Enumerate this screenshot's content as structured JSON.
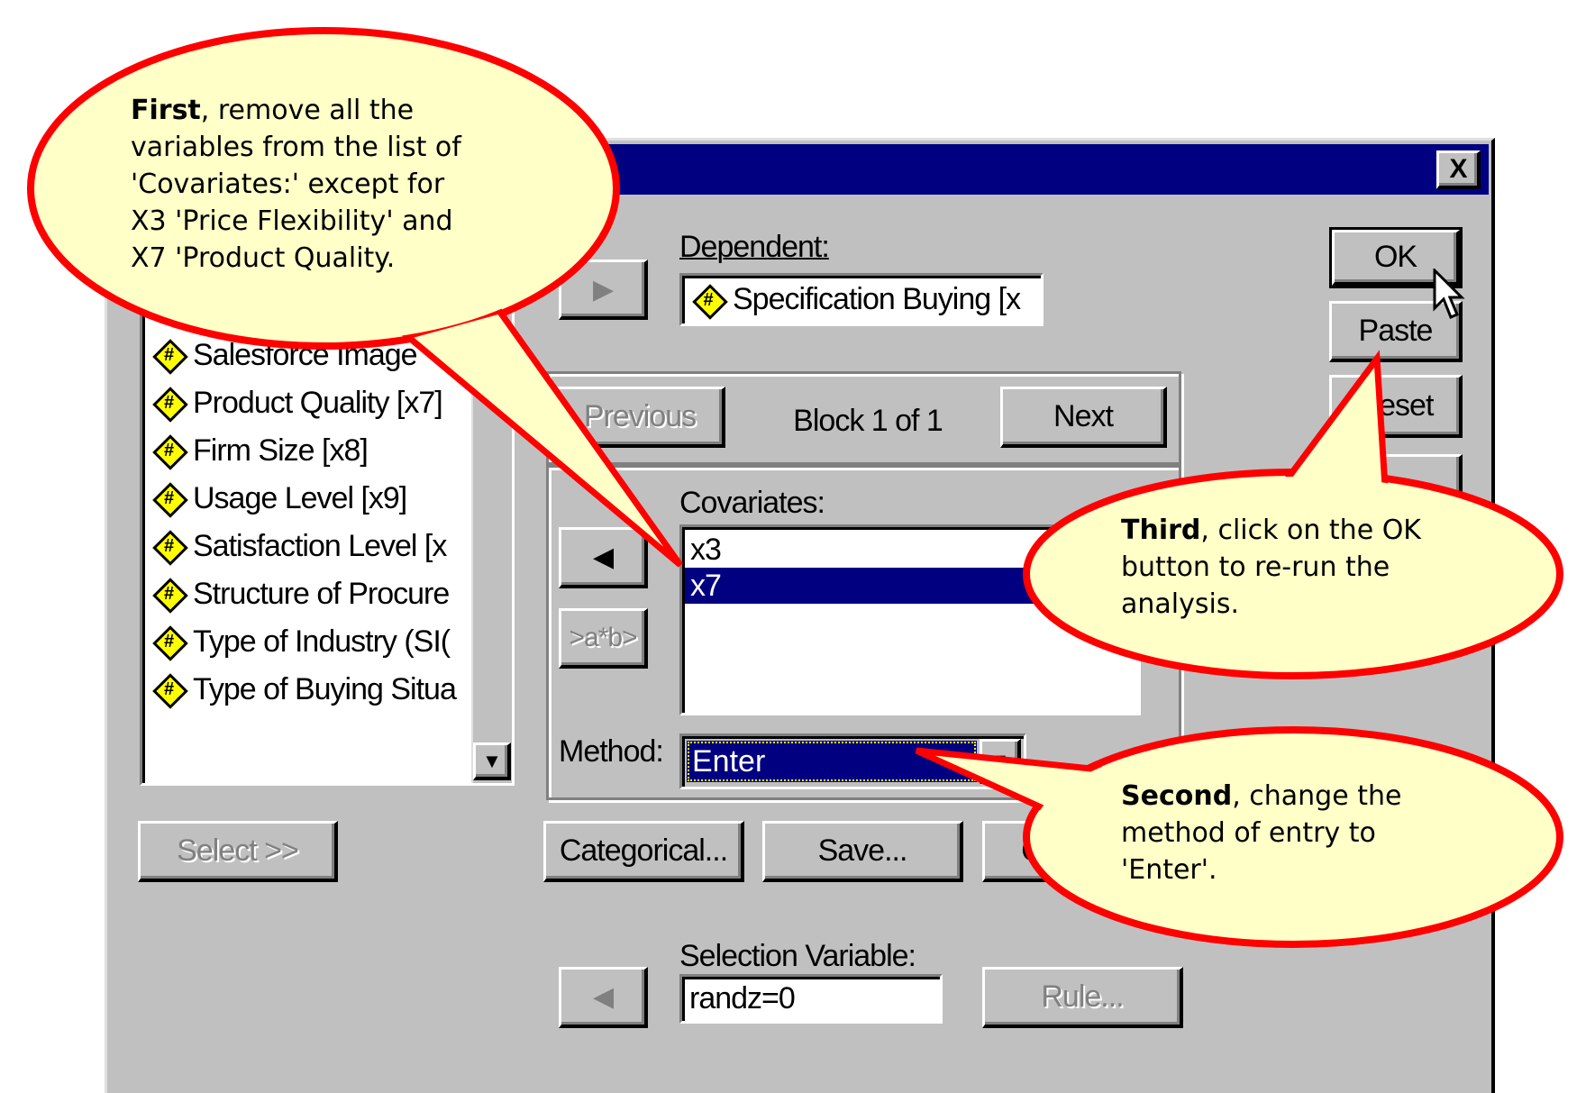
{
  "dialog": {
    "close_label": "X",
    "variable_list": [
      "Salesforce Image",
      "Product Quality [x7]",
      "Firm Size [x8]",
      "Usage Level [x9]",
      "Satisfaction Level [x",
      "Structure of Procure",
      "Type of Industry (SI(",
      "Type of Buying Situa"
    ],
    "select_button": "Select >>",
    "dependent_label": "Dependent:",
    "dependent_value": "Specification Buying [x",
    "ok": "OK",
    "paste": "Paste",
    "reset": "Reset",
    "previous": "Previous",
    "block_text": "Block 1 of 1",
    "next": "Next",
    "covariates_label": "Covariates:",
    "covariates": [
      "x3",
      "x7"
    ],
    "selected_covariate": "x7",
    "interaction_button": ">a*b>",
    "method_label": "Method:",
    "method_value": "Enter",
    "categorical": "Categorical...",
    "save": "Save...",
    "options": "Options...",
    "selection_variable_label": "Selection Variable:",
    "selection_variable_value": "randz=0",
    "rule": "Rule..."
  },
  "callouts": {
    "first": {
      "bold": "First",
      "lines": [
        ", remove all the",
        "variables from the list of",
        "'Covariates:' except for",
        "X3 'Price Flexibility' and",
        "X7 'Product Quality."
      ]
    },
    "third": {
      "bold": "Third",
      "lines": [
        ", click on the OK",
        "button to re-run the",
        "analysis."
      ]
    },
    "second": {
      "bold": "Second",
      "lines": [
        ", change the",
        "method of entry to",
        "'Enter'."
      ]
    }
  },
  "colors": {
    "titlebar": "#000080",
    "callout_fill": "#ffffc8",
    "callout_stroke": "#ff0000",
    "dialog": "#c0c0c0"
  }
}
